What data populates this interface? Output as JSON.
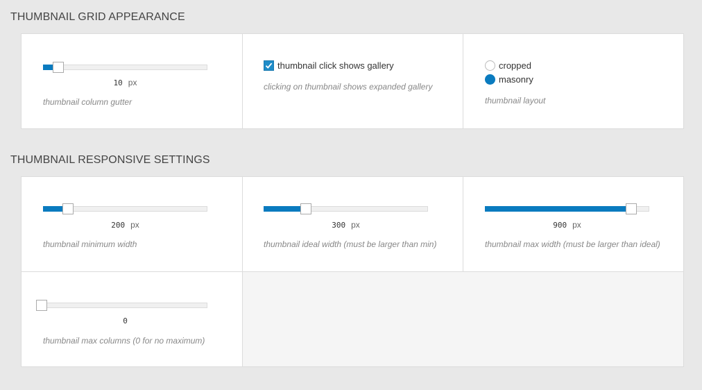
{
  "sections": {
    "appearance": {
      "title": "THUMBNAIL GRID APPEARANCE",
      "gutter": {
        "value": "10",
        "unit": "px",
        "description": "thumbnail column gutter",
        "fraction": 0.09
      },
      "click_gallery": {
        "label": "thumbnail click shows gallery",
        "checked": true,
        "description": "clicking on thumbnail shows expanded gallery"
      },
      "layout": {
        "options": [
          "cropped",
          "masonry"
        ],
        "selected": "masonry",
        "description": "thumbnail layout"
      }
    },
    "responsive": {
      "title": "THUMBNAIL RESPONSIVE SETTINGS",
      "min_width": {
        "value": "200",
        "unit": "px",
        "description": "thumbnail minimum width",
        "fraction": 0.15
      },
      "ideal_width": {
        "value": "300",
        "unit": "px",
        "description": "thumbnail ideal width (must be larger than min)",
        "fraction": 0.25
      },
      "max_width": {
        "value": "900",
        "unit": "px",
        "description": "thumbnail max width (must be larger than ideal)",
        "fraction": 0.89
      },
      "max_columns": {
        "value": "0",
        "unit": "",
        "description": "thumbnail max columns (0 for no maximum)",
        "fraction": 0.0
      }
    }
  },
  "colors": {
    "accent": "#0a7bbf",
    "background": "#e8e8e8",
    "panel": "#ffffff"
  }
}
